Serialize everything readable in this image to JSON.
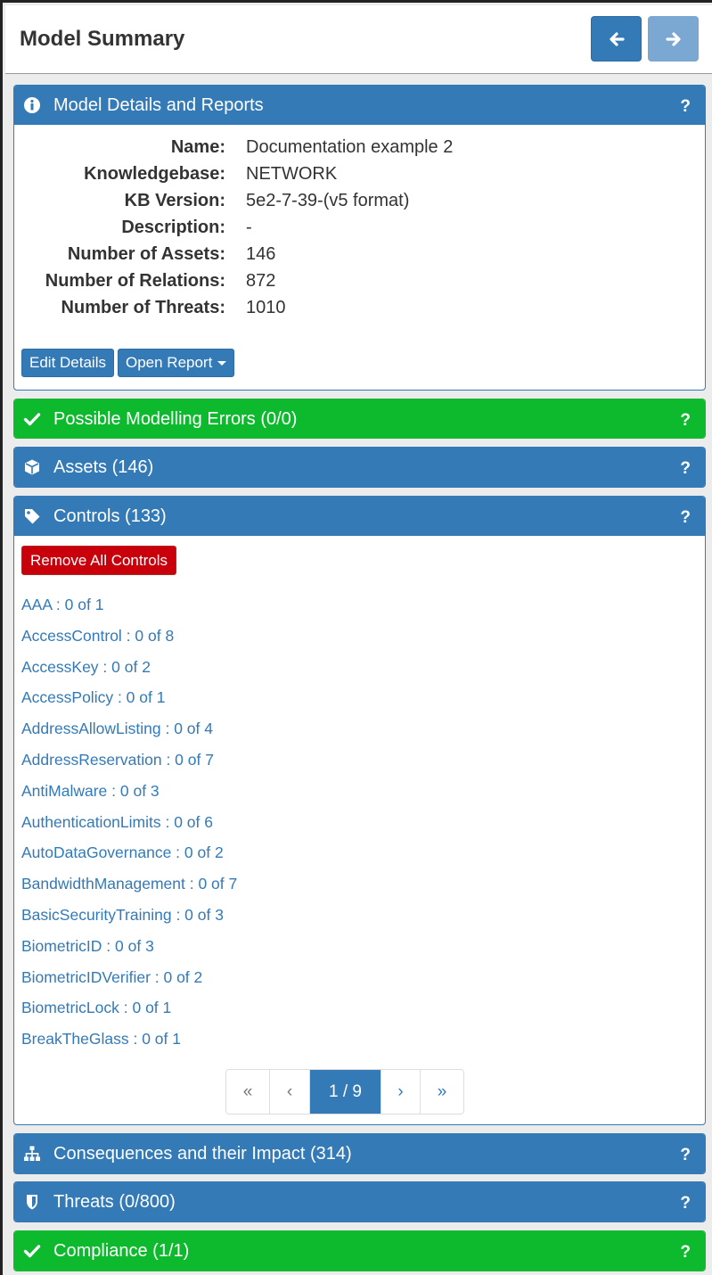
{
  "header": {
    "title": "Model Summary",
    "back_icon": "arrow-left-icon",
    "forward_icon": "arrow-right-icon"
  },
  "colors": {
    "primary": "#337ab7",
    "success": "#0dba2d",
    "danger": "#c9000b",
    "disabled": "#7ba7d3"
  },
  "details_panel": {
    "title": "Model Details and Reports",
    "icon": "info-circle-icon",
    "help": "?",
    "fields": [
      {
        "label": "Name:",
        "value": "Documentation example 2"
      },
      {
        "label": "Knowledgebase:",
        "value": "NETWORK"
      },
      {
        "label": "KB Version:",
        "value": "5e2-7-39-(v5 format)"
      },
      {
        "label": "Description:",
        "value": "-"
      },
      {
        "label": "Number of Assets:",
        "value": "146"
      },
      {
        "label": "Number of Relations:",
        "value": "872"
      },
      {
        "label": "Number of Threats:",
        "value": "1010"
      }
    ],
    "edit_label": "Edit Details",
    "open_report_label": "Open Report"
  },
  "errors_panel": {
    "title": "Possible Modelling Errors (0/0)",
    "icon": "check-icon",
    "help": "?"
  },
  "assets_panel": {
    "title": "Assets (146)",
    "icon": "cube-icon",
    "help": "?"
  },
  "controls_panel": {
    "title": "Controls (133)",
    "icon": "tag-icon",
    "help": "?",
    "remove_all_label": "Remove All Controls",
    "items": [
      "AAA : 0 of 1",
      "AccessControl : 0 of 8",
      "AccessKey : 0 of 2",
      "AccessPolicy : 0 of 1",
      "AddressAllowListing : 0 of 4",
      "AddressReservation : 0 of 7",
      "AntiMalware : 0 of 3",
      "AuthenticationLimits : 0 of 6",
      "AutoDataGovernance : 0 of 2",
      "BandwidthManagement : 0 of 7",
      "BasicSecurityTraining : 0 of 3",
      "BiometricID : 0 of 3",
      "BiometricIDVerifier : 0 of 2",
      "BiometricLock : 0 of 1",
      "BreakTheGlass : 0 of 1"
    ],
    "pager": {
      "first": "«",
      "prev": "‹",
      "current": "1 / 9",
      "next": "›",
      "last": "»"
    }
  },
  "consequences_panel": {
    "title": "Consequences and their Impact (314)",
    "icon": "sitemap-icon",
    "help": "?"
  },
  "threats_panel": {
    "title": "Threats (0/800)",
    "icon": "shield-icon",
    "help": "?"
  },
  "compliance_panel": {
    "title": "Compliance (1/1)",
    "icon": "check-icon",
    "help": "?"
  }
}
